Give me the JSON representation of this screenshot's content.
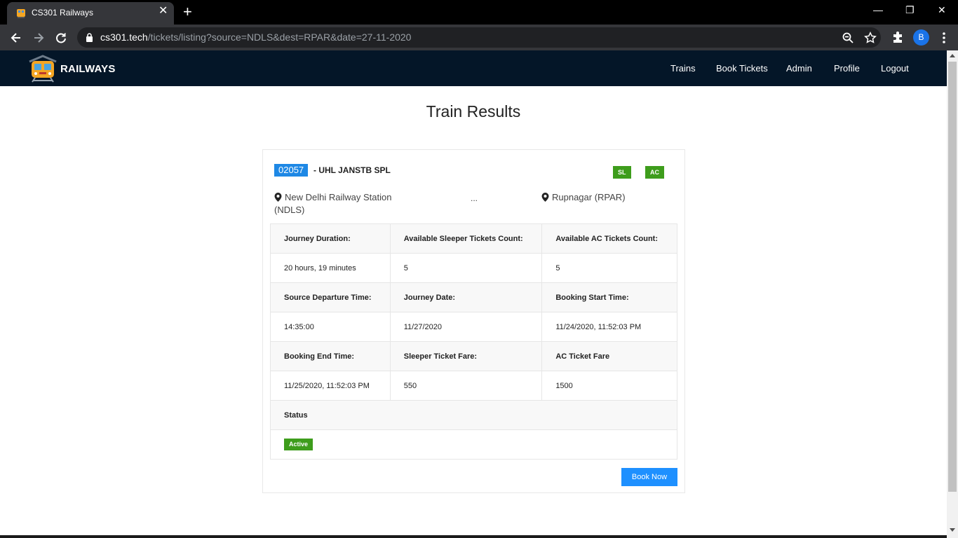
{
  "browser": {
    "tab_title": "CS301 Railways",
    "tab_close": "✕",
    "new_tab": "+",
    "window_controls": {
      "minimize": "—",
      "restore": "❐",
      "close": "✕"
    },
    "url_host": "cs301.tech",
    "url_path": "/tickets/listing?source=NDLS&dest=RPAR&date=27-11-2020",
    "profile_initial": "B",
    "icons": [
      "back-icon",
      "forward-icon",
      "reload-icon",
      "lock-icon",
      "zoom-icon",
      "star-icon",
      "extensions-icon",
      "menu-icon"
    ]
  },
  "navbar": {
    "brand": "RAILWAYS",
    "links": [
      "Trains",
      "Book Tickets",
      "Admin",
      "Profile",
      "Logout"
    ]
  },
  "page": {
    "title": "Train Results"
  },
  "train": {
    "number": "02057",
    "name": "- UHL JANSTB SPL",
    "classes": [
      "SL",
      "AC"
    ],
    "source": "New Delhi Railway Station (NDLS)",
    "separator": "...",
    "destination": "Rupnagar (RPAR)",
    "details": {
      "journey_duration_label": "Journey Duration:",
      "journey_duration": "20 hours, 19 minutes",
      "sleeper_count_label": "Available Sleeper Tickets Count:",
      "sleeper_count": "5",
      "ac_count_label": "Available AC Tickets Count:",
      "ac_count": "5",
      "departure_label": "Source Departure Time:",
      "departure": "14:35:00",
      "journey_date_label": "Journey Date:",
      "journey_date": "11/27/2020",
      "booking_start_label": "Booking Start Time:",
      "booking_start": "11/24/2020, 11:52:03 PM",
      "booking_end_label": "Booking End Time:",
      "booking_end": "11/25/2020, 11:52:03 PM",
      "sleeper_fare_label": "Sleeper Ticket Fare:",
      "sleeper_fare": "550",
      "ac_fare_label": "AC Ticket Fare",
      "ac_fare": "1500",
      "status_label": "Status",
      "status": "Active"
    },
    "book_button": "Book Now"
  },
  "colors": {
    "navbar_bg": "#041628",
    "primary": "#1e88e5",
    "success": "#3e9d1c"
  }
}
